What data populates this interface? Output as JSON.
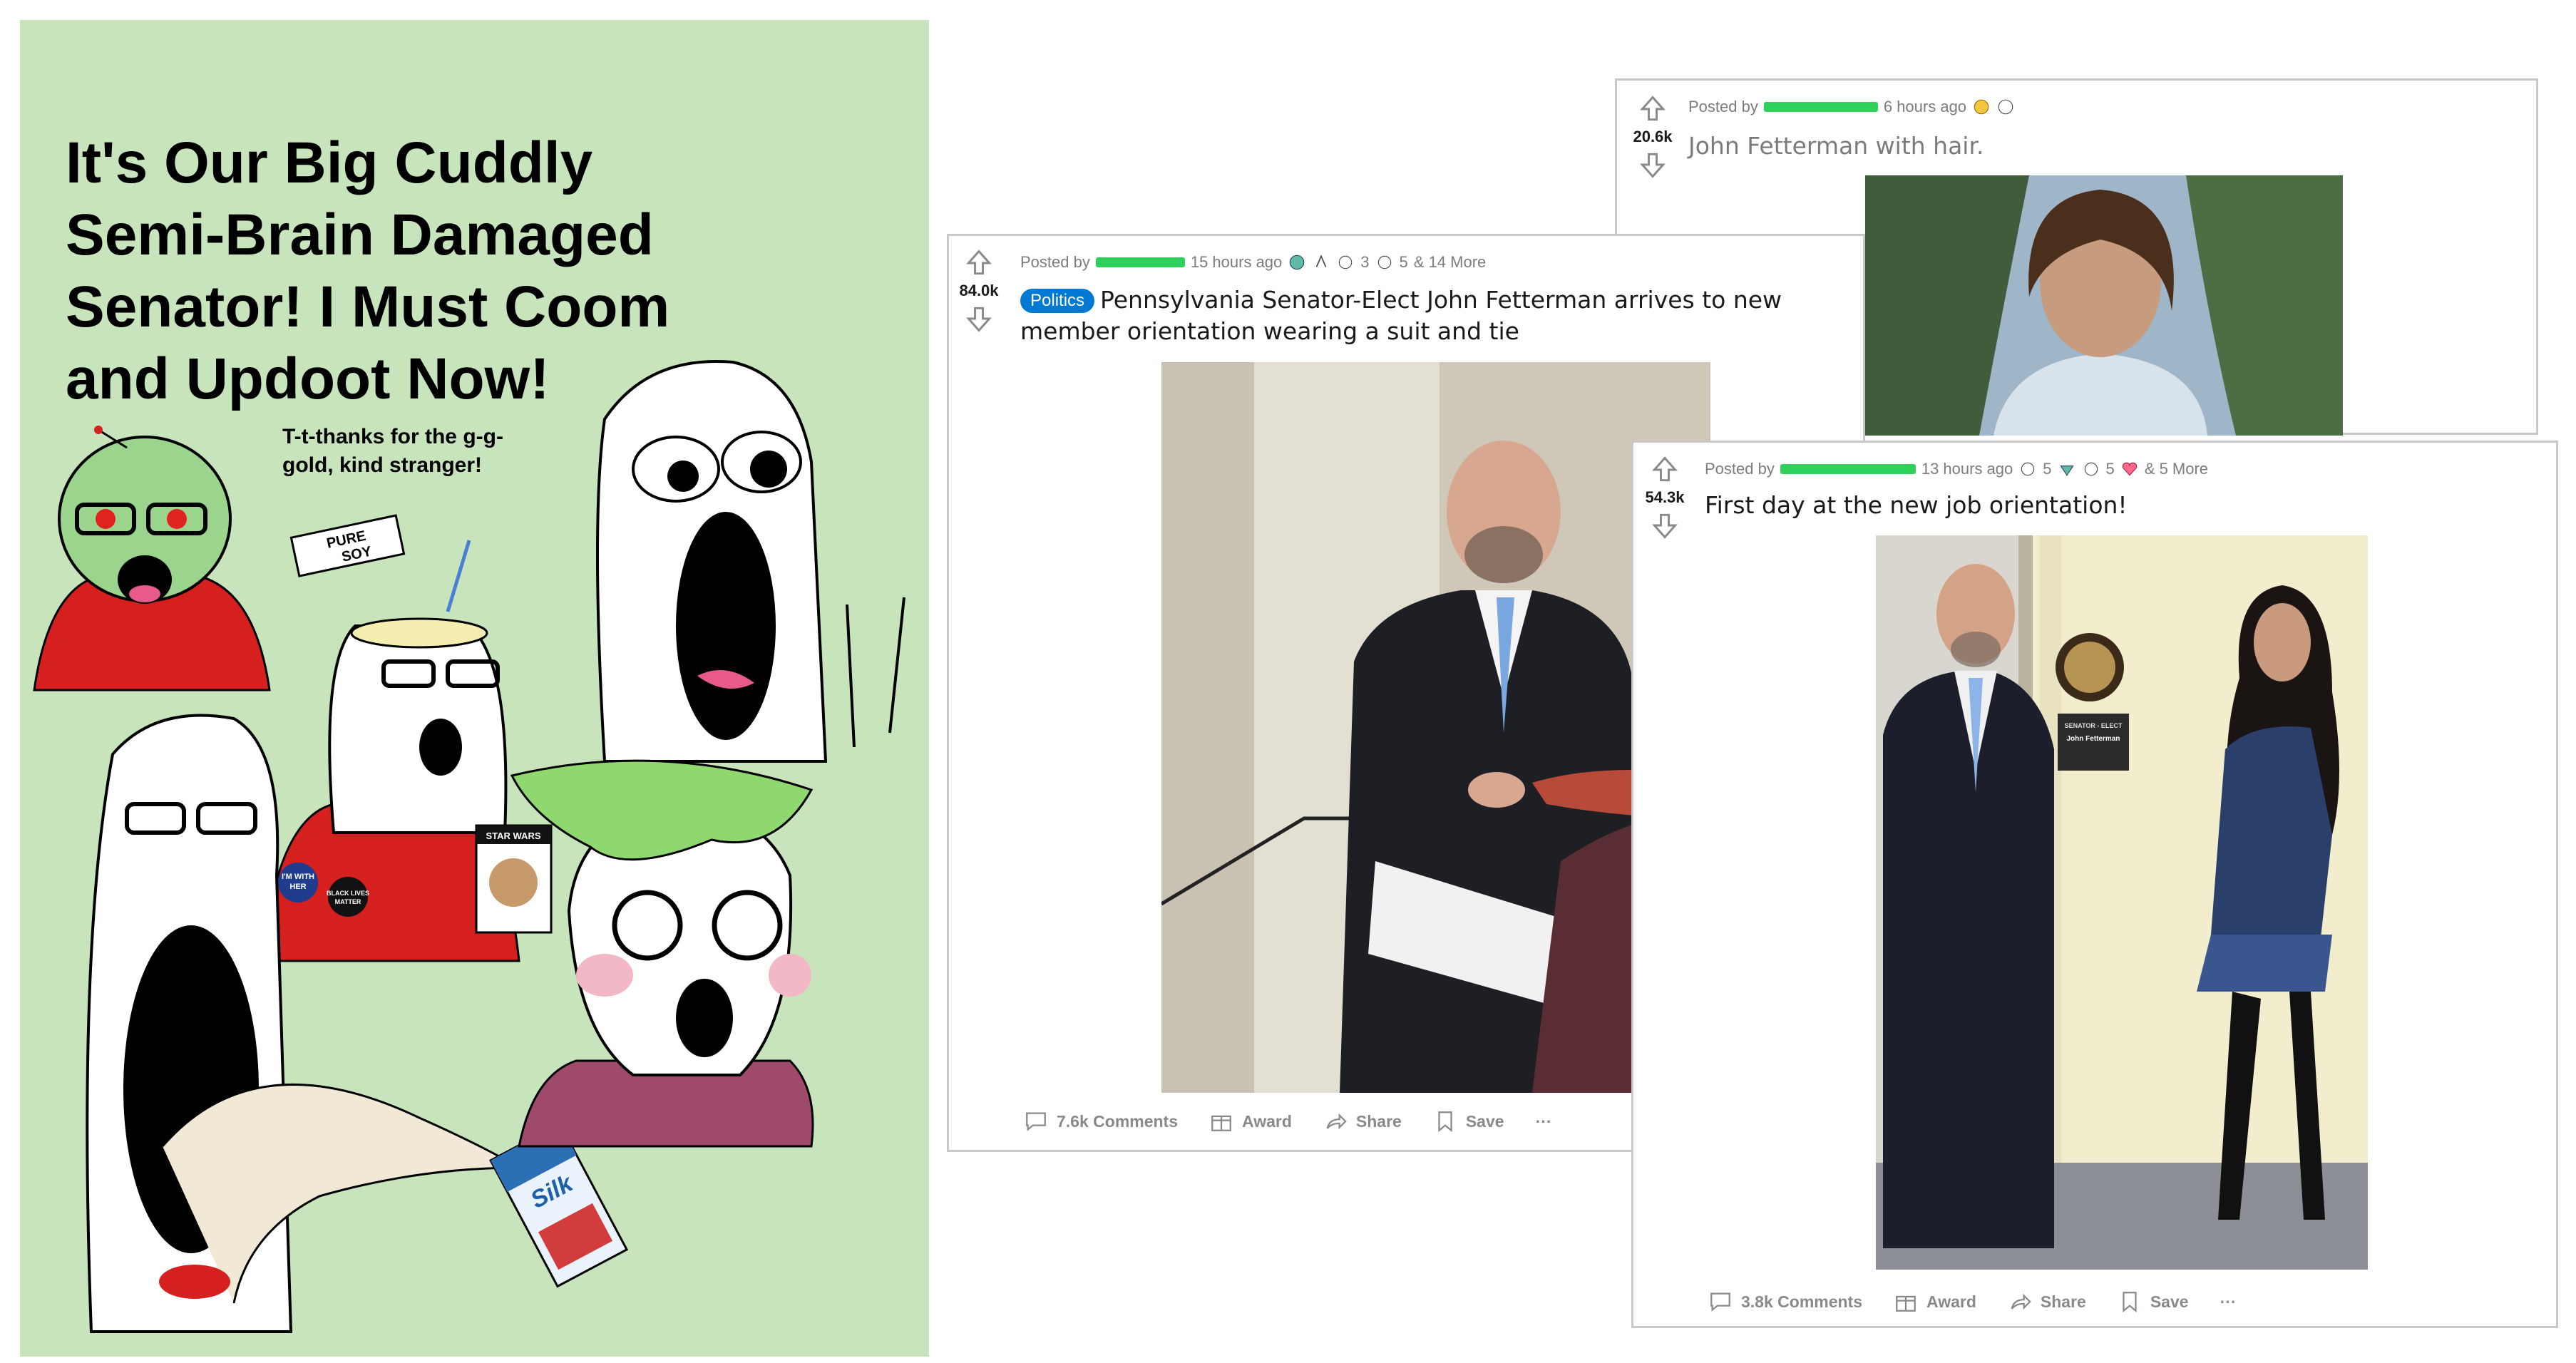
{
  "meme": {
    "title": "It's Our Big Cuddly\nSemi-Brain Damaged\nSenator! I Must Coom\nand Updoot Now!",
    "caption": "T-t-thanks for the g-g-\ngold, kind stranger!",
    "sign_text_1": "PURE",
    "sign_text_2": "SOY",
    "milk_brand": "Silk",
    "badge_1": "I'M WITH HER",
    "badge_2": "BLACK LIVES MATTER",
    "funko_label": "STAR WARS"
  },
  "post_hair": {
    "votes": "20.6k",
    "posted_by": "Posted by",
    "time": "6 hours ago",
    "title": "John Fetterman with hair."
  },
  "post_politics": {
    "votes": "84.0k",
    "posted_by": "Posted by",
    "time": "15 hours ago",
    "award_count_1": "3",
    "award_count_2": "5",
    "more": "& 14 More",
    "flair": "Politics",
    "title": "Pennsylvania Senator-Elect John Fetterman arrives to new member orientation wearing a suit and tie",
    "comments": "7.6k Comments",
    "award": "Award",
    "share": "Share",
    "save": "Save",
    "more_dots": "···"
  },
  "post_first_day": {
    "votes": "54.3k",
    "posted_by": "Posted by",
    "time": "13 hours ago",
    "award_count_1": "5",
    "award_count_2": "5",
    "more": "& 5 More",
    "title": "First day at the new job orientation!",
    "comments": "3.8k Comments",
    "award": "Award",
    "share": "Share",
    "save": "Save",
    "more_dots": "···",
    "nameplate_top": "SENATOR - ELECT",
    "nameplate_name": "John Fetterman"
  },
  "colors": {
    "meme_bg": "#c7e4bd",
    "upvote_gray": "#878a8c",
    "flair_blue": "#0079d3",
    "redaction_green": "#2fd15a"
  },
  "icons": [
    "upvote-icon",
    "downvote-icon",
    "comment-icon",
    "award-icon",
    "share-icon",
    "save-icon",
    "more-icon",
    "award-badge-icon"
  ]
}
